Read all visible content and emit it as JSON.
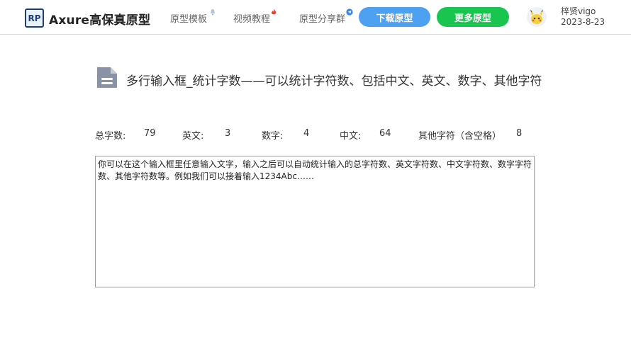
{
  "brand": {
    "badge": "RP",
    "name": "Axure高保真原型"
  },
  "nav": {
    "items": [
      {
        "label": "原型模板",
        "badge_icon": "bell-icon",
        "badge_color": "#9aa9c7"
      },
      {
        "label": "视频教程",
        "badge_icon": "fire-icon",
        "badge_color": "#e8412e"
      },
      {
        "label": "原型分享群",
        "badge_icon": "send-icon",
        "badge_color": "#3a86e8"
      }
    ]
  },
  "buttons": {
    "download": "下载原型",
    "more": "更多原型"
  },
  "colors": {
    "download_button": "#4ea0f0",
    "more_button": "#19c44f",
    "title_icon": "#8a93a5"
  },
  "user": {
    "name": "梓贤vigo",
    "date": "2023-8-23"
  },
  "page": {
    "title": "多行输入框_统计字数——可以统计字符数、包括中文、英文、数字、其他字符",
    "title_icon": "document-icon"
  },
  "stats": [
    {
      "label": "总字数:",
      "value": "79"
    },
    {
      "label": "英文:",
      "value": "3"
    },
    {
      "label": "数字:",
      "value": "4"
    },
    {
      "label": "中文:",
      "value": "64"
    },
    {
      "label": "其他字符（含空格）",
      "value": "8"
    }
  ],
  "textarea": {
    "value": "你可以在这个输入框里任意输入文字，输入之后可以自动统计输入的总字符数、英文字符数、中文字符数、数字字符数、其他字符数等。例如我们可以接着输入1234Abc……"
  }
}
